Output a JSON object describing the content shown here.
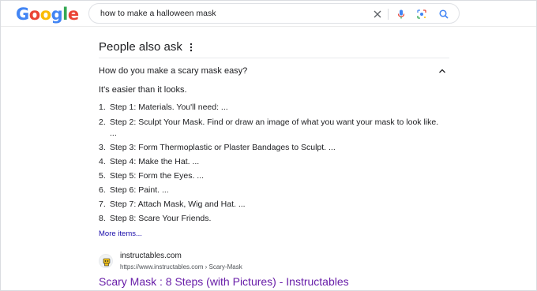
{
  "header": {
    "logo_letters": [
      {
        "ch": "G",
        "color": "#4285F4"
      },
      {
        "ch": "o",
        "color": "#EA4335"
      },
      {
        "ch": "o",
        "color": "#FBBC05"
      },
      {
        "ch": "g",
        "color": "#4285F4"
      },
      {
        "ch": "l",
        "color": "#34A853"
      },
      {
        "ch": "e",
        "color": "#EA4335"
      }
    ],
    "search_query": "how to make a halloween mask",
    "icons": [
      "close-icon",
      "mic-icon",
      "lens-icon",
      "search-icon"
    ]
  },
  "paa": {
    "title": "People also ask",
    "question": "How do you make a scary mask easy?",
    "answer_intro": "It's easier than it looks.",
    "steps": [
      {
        "num": "1.",
        "text": "Step 1: Materials. You'll need: ..."
      },
      {
        "num": "2.",
        "text": "Step 2: Sculpt Your Mask. Find or draw an image of what you want your mask to look like. ..."
      },
      {
        "num": "3.",
        "text": "Step 3: Form Thermoplastic or Plaster Bandages to Sculpt. ..."
      },
      {
        "num": "4.",
        "text": "Step 4: Make the Hat. ..."
      },
      {
        "num": "5.",
        "text": "Step 5: Form the Eyes. ..."
      },
      {
        "num": "6.",
        "text": "Step 6: Paint. ..."
      },
      {
        "num": "7.",
        "text": "Step 7: Attach Mask, Wig and Hat. ..."
      },
      {
        "num": "8.",
        "text": "Step 8: Scare Your Friends."
      }
    ],
    "more_items": "More items..."
  },
  "result": {
    "site_name": "instructables.com",
    "url": "https://www.instructables.com › Scary-Mask",
    "title": "Scary Mask : 8 Steps (with Pictures) - Instructables"
  },
  "colors": {
    "link_blue": "#1a0dab",
    "visited_purple": "#681da8",
    "mic_blue": "#4285F4",
    "search_blue": "#4285F4"
  }
}
